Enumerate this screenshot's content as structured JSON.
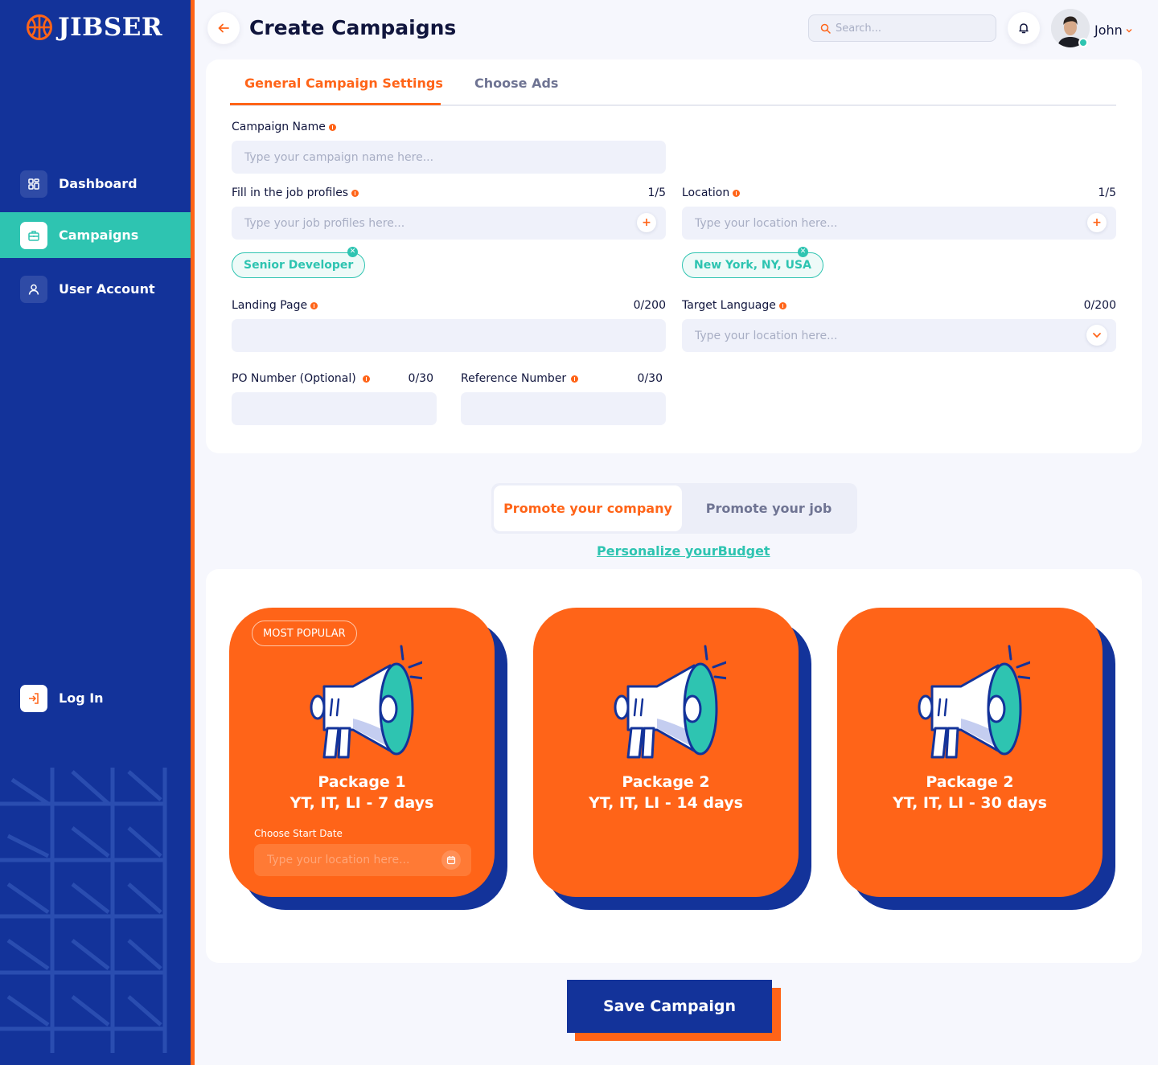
{
  "app": {
    "name": "JIBSER"
  },
  "sidebar": {
    "items": [
      {
        "label": "Dashboard",
        "icon": "dashboard-icon"
      },
      {
        "label": "Campaigns",
        "icon": "briefcase-icon"
      },
      {
        "label": "User Account",
        "icon": "user-icon"
      }
    ],
    "login_label": "Log In"
  },
  "header": {
    "title": "Create Campaigns",
    "search_placeholder": "Search...",
    "user_name": "John"
  },
  "tabs": {
    "active": "General Campaign Settings",
    "inactive": "Choose Ads"
  },
  "form": {
    "campaign_name": {
      "label": "Campaign Name",
      "placeholder": "Type your campaign name here..."
    },
    "job_profiles": {
      "label": "Fill in the job profiles",
      "counter": "1/5",
      "placeholder": "Type your job profiles here...",
      "tag": "Senior Developer"
    },
    "location": {
      "label": "Location",
      "counter": "1/5",
      "placeholder": "Type your location here...",
      "tag": "New York, NY, USA"
    },
    "landing_page": {
      "label": "Landing Page",
      "counter": "0/200"
    },
    "target_language": {
      "label": "Target Language",
      "counter": "0/200",
      "placeholder": "Type your location here..."
    },
    "po_number": {
      "label": "PO Number (Optional)",
      "counter": "0/30"
    },
    "reference_number": {
      "label": "Reference Number",
      "counter": "0/30"
    }
  },
  "promote": {
    "active": "Promote your company",
    "inactive": "Promote your job",
    "link": "Personalize yourBudget"
  },
  "packages": [
    {
      "badge": "MOST POPULAR",
      "line1": "Package 1",
      "line2": "YT, IT, LI - 7 days",
      "date_label": "Choose Start Date",
      "date_placeholder": "Type your location here..."
    },
    {
      "line1": "Package 2",
      "line2": "YT, IT, LI - 14 days"
    },
    {
      "line1": "Package 2",
      "line2": "YT, IT, LI - 30 days"
    }
  ],
  "save_label": "Save Campaign",
  "colors": {
    "sidebar": "#13339a",
    "accent": "#ff6418",
    "teal": "#2ec4b1",
    "text": "#10153d"
  }
}
